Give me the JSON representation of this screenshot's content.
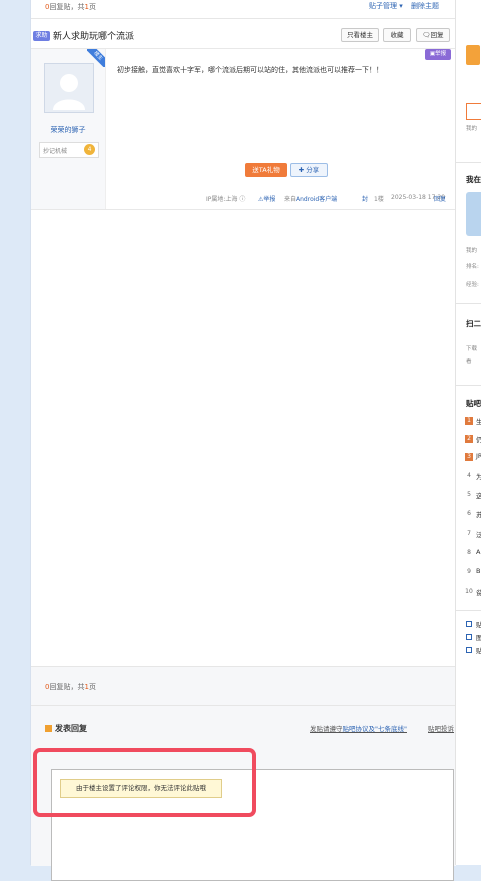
{
  "top_bar": {
    "count_prefix": "0",
    "count_mid": "回复贴，共",
    "count_pages": "1",
    "count_suffix": "页",
    "post_manage": "贴子管理 ▾",
    "delete_topic": "删除主题"
  },
  "thread": {
    "tag": "求助",
    "title": "新人求助玩哪个流派",
    "btn_only_op": "只看楼主",
    "btn_favorite": "收藏",
    "btn_reply": "回复"
  },
  "post": {
    "op_badge": "楼主",
    "author": "荣荣的狮子",
    "level_label": "抄记机械",
    "level_num": "4",
    "content": "初步接触，直觉喜欢十字军，哪个流派后期可以站的住，其他流派也可以推荐一下！！",
    "report_tag": "举报",
    "gift_button": "送TA礼物",
    "share_button": "分享",
    "ip": "IP属地:上海",
    "report": "举报",
    "source_prefix": "来自",
    "source": "Android客户端",
    "floor_ding": "1楼",
    "time": "2025-03-18 17:20",
    "reply": "回复",
    "floor_seal": "封"
  },
  "bottom": {
    "count_prefix": "0",
    "count_mid": "回复贴，共",
    "count_pages": "1",
    "count_suffix": "页",
    "reply_title": "发表回复",
    "rule_text": "发贴请遵守",
    "rule_link": "贴吧协议及\"七条底线\"",
    "complaint": "贴吧投诉",
    "notice": "由于楼主设置了评论权限，你无法评论此贴哦"
  },
  "sidebar": {
    "my_info": "我在",
    "my_name": "我的",
    "rank_label": "排名:",
    "exp_label": "经验:",
    "scan_title": "扫二",
    "download": "下载",
    "watch": "看",
    "hot_title": "贴吧",
    "hot_items": [
      {
        "rank": "1",
        "text": "生"
      },
      {
        "rank": "2",
        "text": "仍"
      },
      {
        "rank": "3",
        "text": "JR"
      },
      {
        "rank": "4",
        "text": "为"
      },
      {
        "rank": "5",
        "text": "这"
      },
      {
        "rank": "6",
        "text": "苏"
      },
      {
        "rank": "7",
        "text": "泛"
      },
      {
        "rank": "8",
        "text": "A"
      },
      {
        "rank": "9",
        "text": "B"
      },
      {
        "rank": "10",
        "text": "贫"
      }
    ],
    "links": [
      "贴",
      "图",
      "贴"
    ]
  }
}
